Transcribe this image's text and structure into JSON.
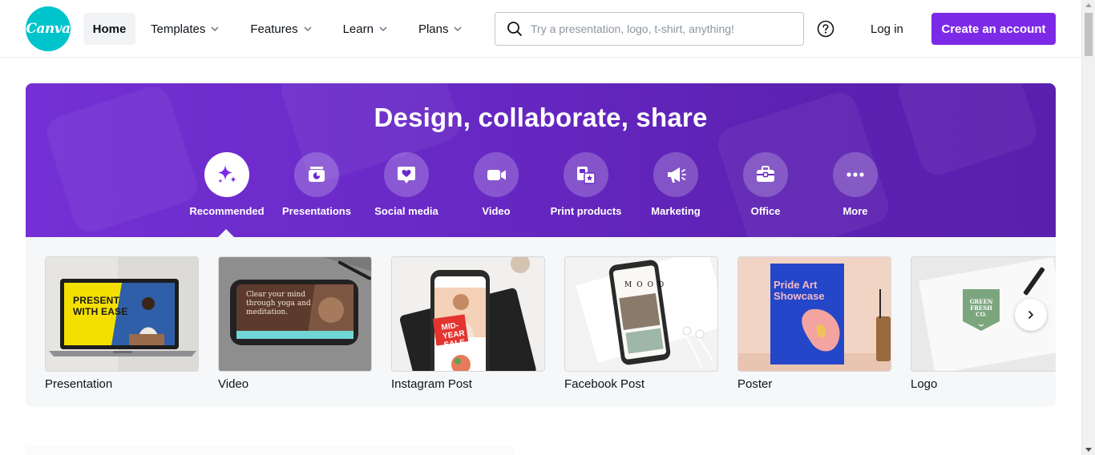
{
  "brand": {
    "logo_text": "Canva",
    "logo_color": "#00c4cc",
    "accent": "#7d2ae8"
  },
  "nav": {
    "home": "Home",
    "templates": "Templates",
    "features": "Features",
    "learn": "Learn",
    "plans": "Plans"
  },
  "search": {
    "placeholder": "Try a presentation, logo, t-shirt, anything!",
    "icon": "search-icon"
  },
  "header_actions": {
    "help_icon": "help-circle-icon",
    "login": "Log in",
    "create": "Create an account"
  },
  "hero": {
    "title": "Design, collaborate, share",
    "colors": {
      "start": "#7430d4",
      "end": "#5a1fad"
    },
    "categories": [
      {
        "label": "Recommended",
        "icon": "sparkle-icon",
        "active": true
      },
      {
        "label": "Presentations",
        "icon": "presentation-icon",
        "active": false
      },
      {
        "label": "Social media",
        "icon": "heart-chat-icon",
        "active": false
      },
      {
        "label": "Video",
        "icon": "video-camera-icon",
        "active": false
      },
      {
        "label": "Print products",
        "icon": "print-products-icon",
        "active": false
      },
      {
        "label": "Marketing",
        "icon": "megaphone-icon",
        "active": false
      },
      {
        "label": "Office",
        "icon": "briefcase-icon",
        "active": false
      },
      {
        "label": "More",
        "icon": "more-dots-icon",
        "active": false
      }
    ]
  },
  "cards": [
    {
      "label": "Presentation",
      "thumb_text": "PRESENT WITH EASE"
    },
    {
      "label": "Video",
      "thumb_text": "Clear your mind through yoga and meditation."
    },
    {
      "label": "Instagram Post",
      "thumb_text": "MID-YEAR SALE"
    },
    {
      "label": "Facebook Post",
      "thumb_text": "MOOD"
    },
    {
      "label": "Poster",
      "thumb_text": "Pride Art Showcase"
    },
    {
      "label": "Logo",
      "thumb_text": "GREEN FRESH CO."
    }
  ],
  "carousel": {
    "next_icon": "chevron-right-icon"
  }
}
